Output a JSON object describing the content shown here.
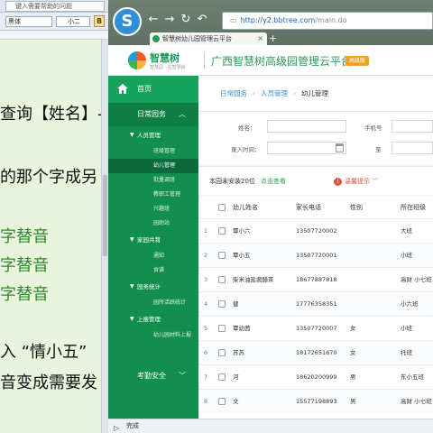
{
  "editor": {
    "help_box": "键入需要帮助的问题",
    "font_name": "黑体",
    "font_size": "小二",
    "bold_label": "B",
    "lines": [
      {
        "text": "查询【姓名】-",
        "color": "normal"
      },
      {
        "text": "的那个字成另",
        "color": "normal"
      },
      {
        "text": "字替音",
        "color": "green"
      },
      {
        "text": "字替音",
        "color": "green"
      },
      {
        "text": "字替音",
        "color": "green"
      },
      {
        "text": "入 “情小五”",
        "color": "normal"
      },
      {
        "text": "音变成需要发",
        "color": "normal"
      }
    ]
  },
  "browser": {
    "url_domain": "http://y2.bbtree.com",
    "url_path": "/main.do",
    "tab_title": "智慧树幼儿园管理云平台",
    "tab_close": "×",
    "new_tab": "+"
  },
  "site": {
    "logo_name": "智慧树",
    "logo_sub": "智慧园 · 在智慧树",
    "title": "广西智慧树高级园管理云平台",
    "badge": "高级版"
  },
  "sidebar": {
    "home": "首页",
    "section": "日常园务",
    "groups": [
      {
        "label": "人员管理",
        "items": [
          {
            "label": "班级管理",
            "active": false
          },
          {
            "label": "幼儿管理",
            "active": true
          },
          {
            "label": "批量调班",
            "active": false
          },
          {
            "label": "教职工管理",
            "active": false
          },
          {
            "label": "兴趣班",
            "active": false
          },
          {
            "label": "园助站",
            "active": false
          }
        ]
      },
      {
        "label": "家园共育",
        "items": [
          {
            "label": "通知",
            "active": false
          },
          {
            "label": "食谱",
            "active": false
          }
        ]
      },
      {
        "label": "园务统计",
        "items": [
          {
            "label": "园所活跃统计",
            "active": false
          }
        ]
      },
      {
        "label": "上报管理",
        "items": [
          {
            "label": "幼儿园材料上报",
            "active": false
          }
        ]
      }
    ],
    "bottom": "考勤安全"
  },
  "breadcrumb": [
    "日常园务",
    "人员管理",
    "幼儿管理"
  ],
  "filters": {
    "name_label": "姓名：",
    "phone_label": "手机号",
    "enroll_label": "录入时间：",
    "to_label": "至"
  },
  "notice": {
    "text": "本园未安装20位",
    "link": "点击查看",
    "warn": "温馨提示"
  },
  "table": {
    "headers": [
      "幼儿姓名",
      "家长电话",
      "性别",
      "所在班级"
    ],
    "rows": [
      {
        "n": "1",
        "name": "覃小六",
        "phone": "13507720002",
        "gender": "",
        "cls": "大班"
      },
      {
        "n": "2",
        "name": "覃小五",
        "phone": "13507720001",
        "gender": "",
        "cls": "小班"
      },
      {
        "n": "3",
        "name": "柴米油盐酱醋茶",
        "phone": "18677887818",
        "gender": "",
        "cls": "高财 小七班"
      },
      {
        "n": "4",
        "name": "健",
        "phone": "17776358351",
        "gender": "",
        "cls": "小六班"
      },
      {
        "n": "5",
        "name": "覃幼茜",
        "phone": "13507720007",
        "gender": "女",
        "cls": "小班"
      },
      {
        "n": "6",
        "name": "苏苏",
        "phone": "18172651670",
        "gender": "女",
        "cls": "托班"
      },
      {
        "n": "7",
        "name": "河",
        "phone": "18620200999",
        "gender": "男",
        "cls": "东小五班"
      },
      {
        "n": "8",
        "name": "文",
        "phone": "15577198893",
        "gender": "男",
        "cls": "高财 小七班"
      }
    ]
  },
  "status": "完成",
  "colors": {
    "brand_green": "#128f4f",
    "accent_orange": "#f0a12a",
    "warn_red": "#e0533c"
  }
}
